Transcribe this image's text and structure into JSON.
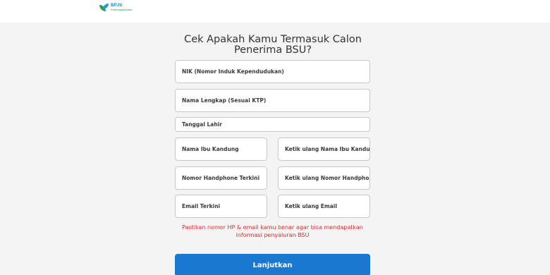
{
  "header": {
    "logo_title": "BPJS",
    "logo_subtitle": "Ketenagakerjaan"
  },
  "form": {
    "title": "Cek Apakah Kamu Termasuk Calon Penerima BSU?",
    "fields": {
      "nik": "NIK (Nomor Induk Kependudukan)",
      "nama": "Nama Lengkap (Sesuai KTP)",
      "tanggal_lahir": "Tanggal Lahir",
      "ibu": "Nama Ibu Kandung",
      "ibu_confirm": "Ketik ulang Nama Ibu Kandung",
      "hp": "Nomor Handphone Terkini",
      "hp_confirm": "Ketik ulang Nomor Handphone",
      "email": "Email Terkini",
      "email_confirm": "Ketik ulang Email"
    },
    "notice": "Pastikan nomor HP & email kamu benar agar bisa mendapatkan informasi penyaluran BSU",
    "submit_label": "Lanjutkan"
  },
  "colors": {
    "primary": "#1b78d0",
    "warning": "#d9302e",
    "logo_blue": "#1a7ec2",
    "logo_green": "#2aa24a"
  }
}
